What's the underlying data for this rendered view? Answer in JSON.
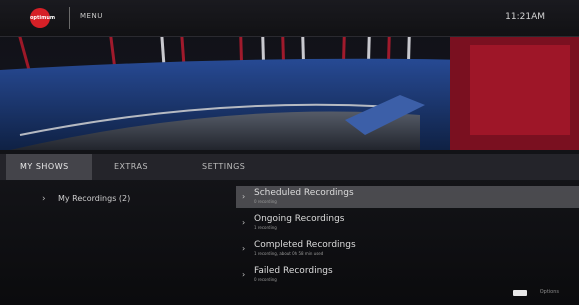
{
  "header": {
    "logo_text": "optimum",
    "menu_label": "MENU",
    "time": "11:21AM"
  },
  "tabs": [
    {
      "label": "MY SHOWS",
      "active": true
    },
    {
      "label": "EXTRAS",
      "active": false
    },
    {
      "label": "SETTINGS",
      "active": false
    }
  ],
  "left_menu": {
    "item_label": "My Recordings (2)"
  },
  "recordings_menu": [
    {
      "title": "Scheduled Recordings",
      "subtitle": "0 recording",
      "selected": true
    },
    {
      "title": "Ongoing Recordings",
      "subtitle": "1 recording",
      "selected": false
    },
    {
      "title": "Completed Recordings",
      "subtitle": "1 recording, about 0h 58 min used",
      "selected": false
    },
    {
      "title": "Failed Recordings",
      "subtitle": "0 recording",
      "selected": false
    }
  ],
  "footer": {
    "hint_text": "Options"
  },
  "colors": {
    "brand_red": "#d62027",
    "stage_red": "#b0182a",
    "stage_blue": "#1c3f86"
  }
}
